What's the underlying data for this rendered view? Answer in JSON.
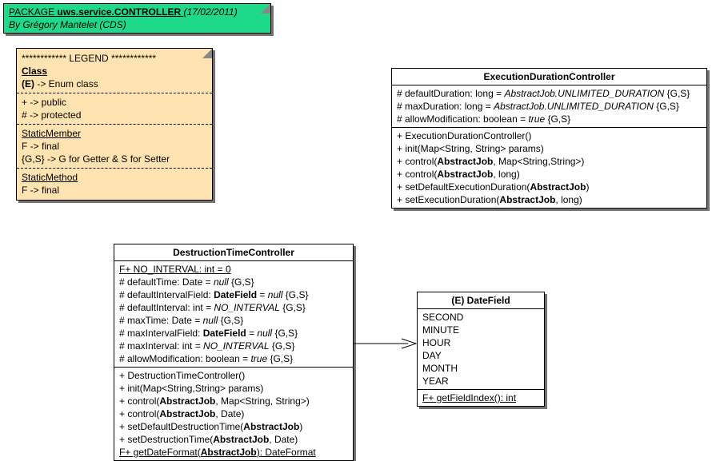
{
  "package": {
    "prefix": "PACKAGE",
    "name": "uws.service.CONTROLLER",
    "date": "(17/02/2011)",
    "author": "By Grégory Mantelet (CDS)"
  },
  "legend": {
    "title": "************ LEGEND ************",
    "h1": "Class",
    "h1sub": "(E) -> Enum class",
    "vis1": "+ -> public",
    "vis2": "# -> protected",
    "m1": "StaticMember",
    "m2": "F -> final",
    "m3": "{G,S} -> G for Getter & S for Setter",
    "s1": "StaticMethod",
    "s2": "F -> final"
  },
  "edc": {
    "title": "ExecutionDurationController",
    "a1p": "# defaultDuration: long = ",
    "a1i": "AbstractJob.UNLIMITED_DURATION",
    "a1s": " {G,S}",
    "a2p": "# maxDuration: long = ",
    "a2i": "AbstractJob.UNLIMITED_DURATION",
    "a2s": " {G,S}",
    "a3p": "# allowModification: boolean = ",
    "a3i": "true",
    "a3s": " {G,S}",
    "m1": "+ ExecutionDurationController()",
    "m2": "+ init(Map<String, String> params)",
    "m3a": "+ control(",
    "m3b": "AbstractJob",
    "m3c": ", Map<String,String>)",
    "m4a": "+ control(",
    "m4b": "AbstractJob",
    "m4c": ", long)",
    "m5a": "+ setDefaultExecutionDuration(",
    "m5b": "AbstractJob",
    "m5c": ")",
    "m6a": "+ setExecutionDuration(",
    "m6b": "AbstractJob",
    "m6c": ", long)"
  },
  "dtc": {
    "title": "DestructionTimeController",
    "c1": "F+ NO_INTERVAL: int = 0",
    "a1a": "# defaultTime: Date = ",
    "a1b": "null",
    "a1c": " {G,S}",
    "a2a": "# defaultIntervalField: ",
    "a2b": "DateField",
    "a2c": " = ",
    "a2d": "null",
    "a2e": " {G,S}",
    "a3a": "# defaultInterval: int = ",
    "a3b": "NO_INTERVAL",
    "a3c": " {G,S}",
    "a4a": "# maxTime: Date = ",
    "a4b": "null",
    "a4c": " {G,S}",
    "a5a": "# maxIntervalField: ",
    "a5b": "DateField",
    "a5c": " = ",
    "a5d": "null",
    "a5e": " {G,S}",
    "a6a": "# maxInterval: int = ",
    "a6b": "NO_INTERVAL",
    "a6c": " {G,S}",
    "a7a": "# allowModification: boolean = ",
    "a7b": "true",
    "a7c": " {G,S}",
    "m1": "+ DestructionTimeController()",
    "m2": "+ init(Map<String,String> params)",
    "m3a": "+ control(",
    "m3b": "AbstractJob",
    "m3c": ", Map<String, String>)",
    "m4a": "+ control(",
    "m4b": "AbstractJob",
    "m4c": ", Date)",
    "m5a": "+ setDefaultDestructionTime(",
    "m5b": "AbstractJob",
    "m5c": ")",
    "m6a": "+ setDestructionTime(",
    "m6b": "AbstractJob",
    "m6c": ", Date)",
    "m7a": "F+ getDateFormat(",
    "m7b": "AbstractJob",
    "m7c": "): DateFormat"
  },
  "df": {
    "title": "(E) DateField",
    "v1": "SECOND",
    "v2": "MINUTE",
    "v3": "HOUR",
    "v4": "DAY",
    "v5": "MONTH",
    "v6": "YEAR",
    "m1": "F+ getFieldIndex(): int"
  }
}
